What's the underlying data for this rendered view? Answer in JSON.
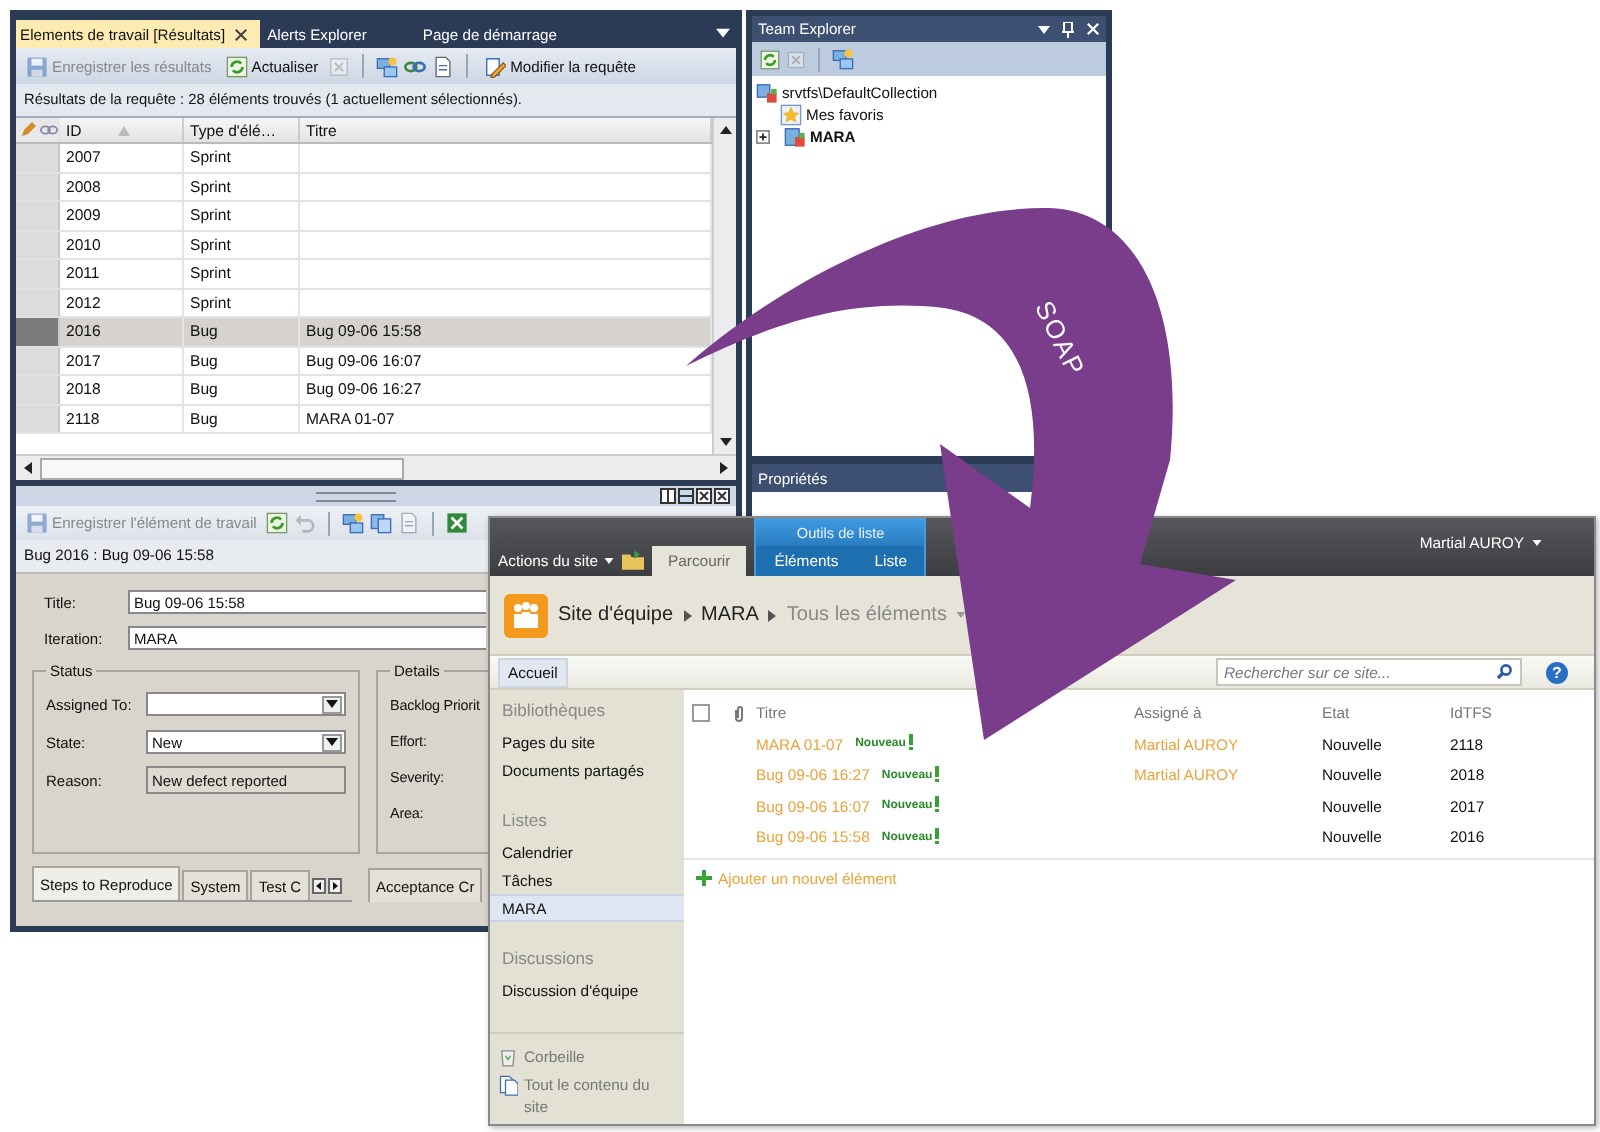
{
  "results_window": {
    "tabs": [
      {
        "label": "Elements de travail [Résultats]",
        "selected": true,
        "closable": true
      },
      {
        "label": "Alerts Explorer",
        "selected": false,
        "closable": false
      },
      {
        "label": "Page de démarrage",
        "selected": false,
        "closable": false
      }
    ],
    "toolbar": [
      {
        "kind": "save",
        "label": "Enregistrer les résultats",
        "disabled": true
      },
      {
        "kind": "refresh",
        "label": "Actualiser",
        "disabled": false
      },
      {
        "kind": "delete",
        "disabled": true
      },
      {
        "kind": "separator"
      },
      {
        "kind": "link-add",
        "disabled": false
      },
      {
        "kind": "link",
        "disabled": false
      },
      {
        "kind": "document",
        "disabled": false
      },
      {
        "kind": "separator"
      },
      {
        "kind": "edit",
        "label": "Modifier la requête",
        "disabled": false
      }
    ],
    "summary": "Résultats de la requête : 28 éléments trouvés (1 actuellement sélectionnés).",
    "columns": [
      "ID",
      "Type d'élé…",
      "Titre"
    ],
    "rows": [
      {
        "id": "2007",
        "type": "Sprint",
        "selected": false
      },
      {
        "id": "2008",
        "type": "Sprint",
        "selected": false
      },
      {
        "id": "2009",
        "type": "Sprint",
        "selected": false
      },
      {
        "id": "2010",
        "type": "Sprint",
        "selected": false
      },
      {
        "id": "2011",
        "type": "Sprint",
        "selected": false
      },
      {
        "id": "2012",
        "type": "Sprint",
        "selected": false
      },
      {
        "id": "2016",
        "type": "Bug",
        "title": "Bug 09-06 15:58",
        "selected": true
      },
      {
        "id": "2017",
        "type": "Bug",
        "title": "Bug 09-06 16:07",
        "selected": false
      },
      {
        "id": "2018",
        "type": "Bug",
        "title": "Bug 09-06 16:27",
        "selected": false
      },
      {
        "id": "2118",
        "type": "Bug",
        "title": "MARA 01-07",
        "selected": false
      }
    ]
  },
  "work_item": {
    "toolbar": [
      {
        "kind": "save",
        "label": "Enregistrer l'élément de travail",
        "disabled": true
      },
      {
        "kind": "refresh",
        "disabled": false
      },
      {
        "kind": "undo",
        "disabled": true
      },
      {
        "kind": "separator"
      },
      {
        "kind": "link-add",
        "disabled": false
      },
      {
        "kind": "copy",
        "disabled": false
      },
      {
        "kind": "document",
        "disabled": true
      },
      {
        "kind": "separator"
      },
      {
        "kind": "excel",
        "disabled": false
      }
    ],
    "heading": "Bug 2016 : Bug 09-06 15:58",
    "title_label": "Title:",
    "title_value": "Bug 09-06 15:58",
    "iteration_label": "Iteration:",
    "iteration_value": "MARA",
    "status": {
      "heading": "Status",
      "fields": [
        {
          "kind": "dropdown",
          "label": "Assigned To:"
        },
        {
          "kind": "dropdown",
          "label": "State:",
          "value": "New"
        },
        {
          "kind": "readonly",
          "label": "Reason:",
          "value": "New defect reported"
        }
      ]
    },
    "details": {
      "heading": "Details",
      "labels": [
        "Backlog Priorit",
        "Effort:",
        "Severity:",
        "Area:"
      ]
    },
    "tabs": [
      {
        "label": "Steps to Reproduce",
        "selected": true
      },
      {
        "label": "System",
        "selected": false
      },
      {
        "label": "Test C",
        "selected": false
      }
    ],
    "side_tab": "Acceptance Cr"
  },
  "team_explorer": {
    "title": "Team Explorer",
    "tree": [
      {
        "kind": "collection",
        "label": "srvtfs\\DefaultCollection",
        "children": [
          {
            "kind": "favorites",
            "label": "Mes favoris"
          },
          {
            "kind": "project",
            "label": "MARA",
            "expanded": false
          }
        ]
      }
    ],
    "properties_title": "Propriétés"
  },
  "arrow": {
    "label": "SOAP"
  },
  "sharepoint": {
    "site_actions": "Actions du site",
    "tabs": [
      {
        "label": "Parcourir",
        "selected": true
      }
    ],
    "contextual_group": {
      "label": "Outils de liste",
      "tabs": [
        {
          "label": "Éléments",
          "selected": false
        },
        {
          "label": "Liste",
          "selected": false
        }
      ]
    },
    "user": "Martial AUROY",
    "breadcrumb": [
      "Site d'équipe",
      "MARA",
      "Tous les éléments"
    ],
    "nav_tab": "Accueil",
    "search": {
      "placeholder": "Rechercher sur ce site..."
    },
    "help": "?",
    "quick_launch": [
      {
        "heading": "Bibliothèques",
        "items": [
          {
            "label": "Pages du site",
            "selected": false
          },
          {
            "label": "Documents partagés",
            "selected": false
          }
        ]
      },
      {
        "heading": "Listes",
        "items": [
          {
            "label": "Calendrier",
            "selected": false
          },
          {
            "label": "Tâches",
            "selected": false
          },
          {
            "label": "MARA",
            "selected": true
          }
        ]
      },
      {
        "heading": "Discussions",
        "items": [
          {
            "label": "Discussion d'équipe",
            "selected": false
          }
        ]
      }
    ],
    "footer_links": [
      {
        "kind": "recycle",
        "label": "Corbeille"
      },
      {
        "kind": "contents",
        "label": "Tout le contenu du site"
      }
    ],
    "list": {
      "all_selected": false,
      "columns": [
        "Titre",
        "Assigné à",
        "Etat",
        "IdTFS"
      ],
      "rows": [
        {
          "title": "MARA 01-07",
          "badge": "Nouveau",
          "assigned_to": "Martial AUROY",
          "state": "Nouvelle",
          "id": "2118"
        },
        {
          "title": "Bug 09-06 16:27",
          "badge": "Nouveau",
          "assigned_to": "Martial AUROY",
          "state": "Nouvelle",
          "id": "2018"
        },
        {
          "title": "Bug 09-06 16:07",
          "badge": "Nouveau",
          "state": "Nouvelle",
          "id": "2017"
        },
        {
          "title": "Bug 09-06 15:58",
          "badge": "Nouveau",
          "state": "Nouvelle",
          "id": "2016"
        }
      ],
      "add_item": "Ajouter un nouvel élément"
    }
  }
}
